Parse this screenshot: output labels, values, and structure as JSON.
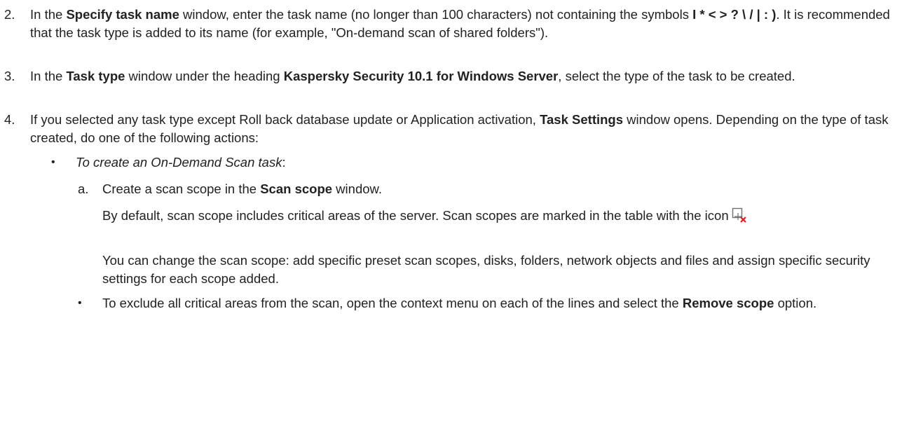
{
  "steps": [
    {
      "number": "2.",
      "t1": "In the ",
      "b1": "Specify task name",
      "t2": " window, enter the task name (no longer than 100 characters) not containing the symbols ",
      "b2": "I * < > ? \\ / | : )",
      "t3": ". It is recommended that the task type is added to its name (for example, \"On-demand scan of shared folders\")."
    },
    {
      "number": "3.",
      "t1": "In the ",
      "b1": "Task type",
      "t2": " window under the heading ",
      "b2": "Kaspersky Security 10.1 for Windows Server",
      "t3": ", select the type of the task to be created."
    },
    {
      "number": "4.",
      "t1": "If you selected any task type except Roll back database update or Application activation, ",
      "b1": "Task Settings",
      "t2": " window opens. Depending on the type of task created, do one of the following actions:"
    }
  ],
  "bullet": {
    "symbol": "•",
    "italic": "To create an On-Demand Scan task",
    "tail": ":"
  },
  "substep": {
    "letter": "a.",
    "t1": "Create a scan scope in the ",
    "b1": "Scan scope",
    "t2": " window."
  },
  "paragraphs": {
    "p1": "By default, scan scope includes critical areas of the server. Scan scopes are marked in the table with the icon",
    "p1_icon": "scan-scope-icon",
    "p2": "You can change the scan scope: add specific preset scan scopes, disks, folders, network objects and files and assign specific security settings for each scope added."
  },
  "sub_bullet": {
    "symbol": "•",
    "t1": "To exclude all critical areas from the scan, open the context menu on each of the lines and select the ",
    "b1": "Remove scope",
    "t2": " option."
  },
  "colors": {
    "text": "#222222",
    "icon_red": "#e02020",
    "icon_gray": "#707070"
  }
}
